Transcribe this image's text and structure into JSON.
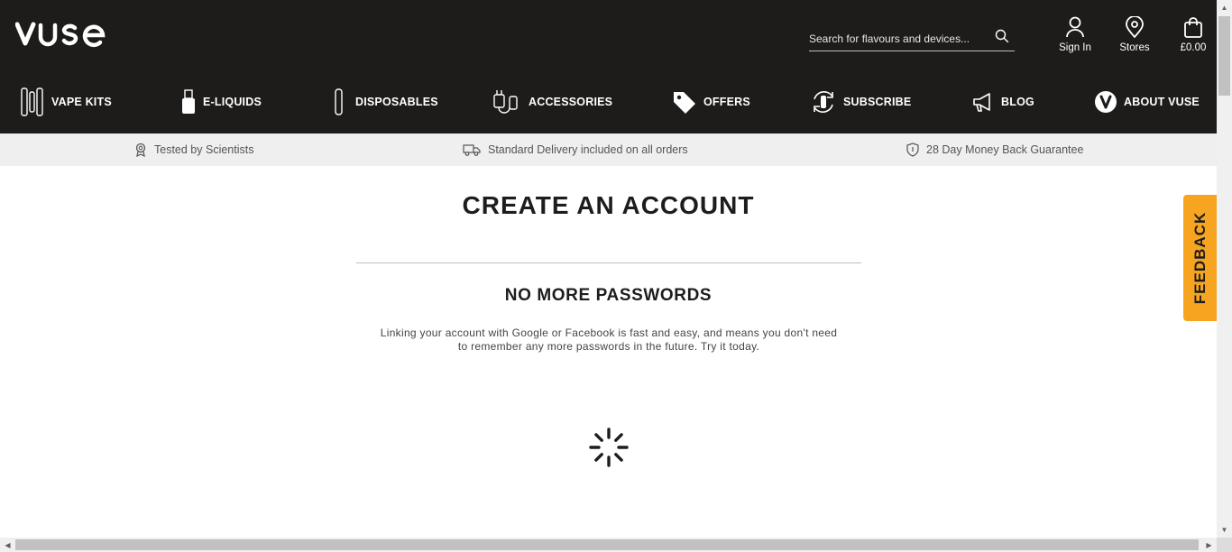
{
  "header": {
    "logo_text": "vuse",
    "search": {
      "placeholder": "Search for flavours and devices..."
    },
    "actions": {
      "signin": "Sign In",
      "stores": "Stores",
      "cart": "£0.00"
    }
  },
  "nav": [
    {
      "label": "VAPE KITS",
      "icon": "vape-kits-icon"
    },
    {
      "label": "E-LIQUIDS",
      "icon": "e-liquids-icon"
    },
    {
      "label": "DISPOSABLES",
      "icon": "disposables-icon"
    },
    {
      "label": "ACCESSORIES",
      "icon": "accessories-icon"
    },
    {
      "label": "OFFERS",
      "icon": "offers-tag-icon"
    },
    {
      "label": "SUBSCRIBE",
      "icon": "subscribe-icon"
    },
    {
      "label": "BLOG",
      "icon": "megaphone-icon"
    },
    {
      "label": "ABOUT VUSE",
      "icon": "vuse-v-icon"
    }
  ],
  "usp": [
    {
      "text": "Tested by Scientists",
      "icon": "award-icon"
    },
    {
      "text": "Standard Delivery included on all orders",
      "icon": "delivery-truck-icon"
    },
    {
      "text": "28 Day Money Back Guarantee",
      "icon": "shield-icon"
    }
  ],
  "main": {
    "title": "CREATE AN ACCOUNT",
    "subtitle": "NO MORE PASSWORDS",
    "description": "Linking your account with Google or Facebook is fast and easy, and means you don't need to remember any more passwords in the future. Try it today."
  },
  "feedback": {
    "label": "FEEDBACK"
  },
  "colors": {
    "header_bg": "#1d1c1a",
    "usp_bg": "#efefef",
    "feedback_bg": "#f7a520",
    "text": "#1d1d1b"
  }
}
